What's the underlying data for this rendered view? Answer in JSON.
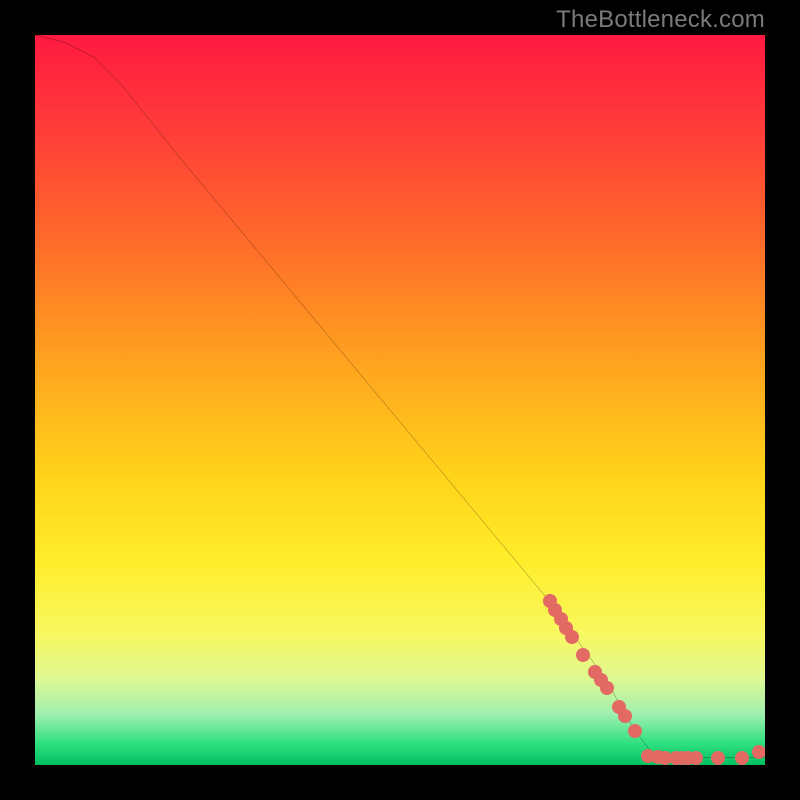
{
  "watermark": "TheBottleneck.com",
  "chart_data": {
    "type": "line",
    "title": "",
    "xlabel": "",
    "ylabel": "",
    "xlim": [
      0,
      100
    ],
    "ylim": [
      0,
      100
    ],
    "background": {
      "type": "vertical-gradient",
      "stops": [
        {
          "pos": 0,
          "color": "#ff1a40"
        },
        {
          "pos": 60,
          "color": "#ffd21a"
        },
        {
          "pos": 82,
          "color": "#f8f860"
        },
        {
          "pos": 97,
          "color": "#30e080"
        },
        {
          "pos": 100,
          "color": "#00c060"
        }
      ]
    },
    "series": [
      {
        "name": "bottleneck-curve",
        "color": "#000000",
        "x": [
          0,
          4,
          8,
          12,
          20,
          30,
          40,
          50,
          60,
          70,
          78,
          82,
          85,
          100
        ],
        "y": [
          100,
          99,
          97,
          93,
          83,
          71,
          59,
          47,
          35,
          23,
          12,
          5,
          1,
          1
        ]
      }
    ],
    "markers": [
      {
        "name": "cluster-upper",
        "color": "#e26a63",
        "points": [
          {
            "x": 70.5,
            "y": 22.5
          },
          {
            "x": 71.2,
            "y": 21.3
          },
          {
            "x": 72.0,
            "y": 20.0
          },
          {
            "x": 72.8,
            "y": 18.8
          },
          {
            "x": 73.6,
            "y": 17.6
          },
          {
            "x": 75.1,
            "y": 15.1
          },
          {
            "x": 76.7,
            "y": 12.7
          },
          {
            "x": 77.5,
            "y": 11.6
          },
          {
            "x": 78.3,
            "y": 10.5
          },
          {
            "x": 80.0,
            "y": 7.9
          },
          {
            "x": 80.8,
            "y": 6.7
          },
          {
            "x": 82.2,
            "y": 4.6
          }
        ]
      },
      {
        "name": "baseline-dots",
        "color": "#e26a63",
        "points": [
          {
            "x": 84.0,
            "y": 1.3
          },
          {
            "x": 85.4,
            "y": 1.1
          },
          {
            "x": 86.3,
            "y": 1.0
          },
          {
            "x": 87.8,
            "y": 1.0
          },
          {
            "x": 88.6,
            "y": 1.0
          },
          {
            "x": 89.4,
            "y": 1.0
          },
          {
            "x": 90.6,
            "y": 1.0
          },
          {
            "x": 93.5,
            "y": 1.0
          },
          {
            "x": 96.8,
            "y": 1.0
          },
          {
            "x": 99.2,
            "y": 1.8
          }
        ]
      }
    ]
  }
}
